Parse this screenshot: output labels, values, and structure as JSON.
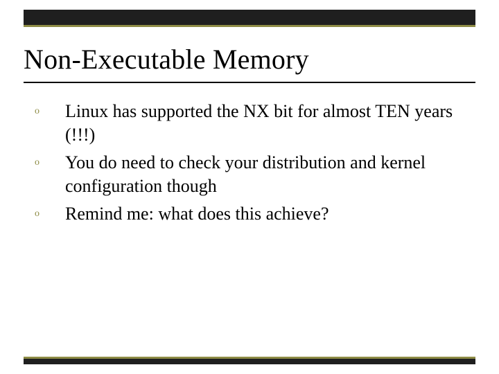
{
  "title": "Non-Executable Memory",
  "bullets": [
    "Linux has supported the NX bit for almost TEN years (!!!)",
    "You do need to check your distribution and kernel configuration though",
    "Remind me: what does this achieve?"
  ],
  "bullet_glyph": "o"
}
